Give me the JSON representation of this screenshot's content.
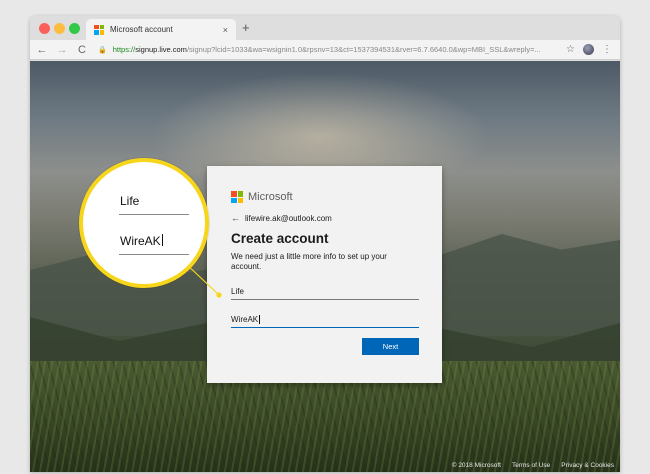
{
  "browser": {
    "tab_title": "Microsoft account",
    "tab_close": "×",
    "new_tab": "+",
    "back": "←",
    "forward": "→",
    "reload": "C",
    "url_scheme": "https://",
    "url_host": "signup.live.com",
    "url_rest": "/signup?lcid=1033&wa=wsignin1.0&rpsnv=13&ct=1537394531&rver=6.7.6640.0&wp=MBI_SSL&wreply=...",
    "bookmark_star": "☆",
    "menu": "⋮"
  },
  "card": {
    "brand": "Microsoft",
    "identity_email": "lifewire.ak@outlook.com",
    "title": "Create account",
    "description": "We need just a little more info to set up your account.",
    "first_name_value": "Life",
    "last_name_value": "WireAK",
    "next_label": "Next"
  },
  "magnifier": {
    "first_name_value": "Life",
    "last_name_value": "WireAK"
  },
  "footer": {
    "copyright": "© 2018 Microsoft",
    "terms": "Terms of Use",
    "privacy": "Privacy & Cookies"
  },
  "colors": {
    "ms_red": "#f25022",
    "ms_green": "#7fba00",
    "ms_blue": "#00a4ef",
    "ms_yellow": "#ffb900",
    "accent_blue": "#0067b8",
    "callout_yellow": "#f7d51a"
  }
}
